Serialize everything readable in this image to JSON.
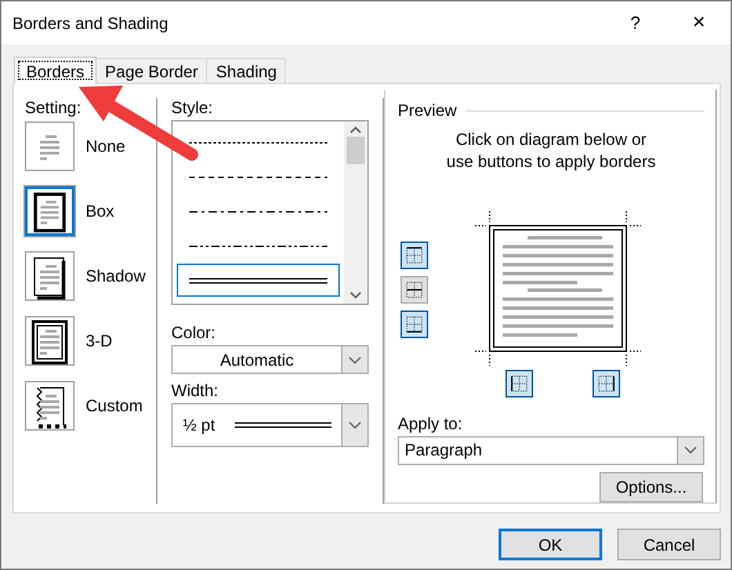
{
  "window": {
    "title": "Borders and Shading",
    "help": "?",
    "close": "×"
  },
  "tabs": [
    {
      "label": "Borders",
      "selected": true
    },
    {
      "label": "Page Border",
      "selected": false
    },
    {
      "label": "Shading",
      "selected": false
    }
  ],
  "setting": {
    "label": "Setting:",
    "items": [
      {
        "label": "None",
        "kind": "none",
        "selected": false
      },
      {
        "label": "Box",
        "kind": "box",
        "selected": true
      },
      {
        "label": "Shadow",
        "kind": "shadow",
        "selected": false
      },
      {
        "label": "3-D",
        "kind": "threed",
        "selected": false
      },
      {
        "label": "Custom",
        "kind": "custom",
        "selected": false
      }
    ]
  },
  "style": {
    "label": "Style:",
    "items": [
      {
        "kind": "dotted",
        "selected": false
      },
      {
        "kind": "dashed",
        "selected": false
      },
      {
        "kind": "dash-dot",
        "selected": false
      },
      {
        "kind": "dash-dot-dot",
        "selected": false
      },
      {
        "kind": "double",
        "selected": true
      }
    ]
  },
  "color": {
    "label": "Color:",
    "value": "Automatic"
  },
  "width": {
    "label": "Width:",
    "value": "½ pt"
  },
  "preview": {
    "label": "Preview",
    "hint": "Click on diagram below or\nuse buttons to apply borders",
    "buttons": [
      {
        "kind": "top",
        "on": true
      },
      {
        "kind": "inside-horizontal",
        "on": false
      },
      {
        "kind": "bottom",
        "on": true
      },
      {
        "kind": "left",
        "on": true
      },
      {
        "kind": "right",
        "on": true
      }
    ]
  },
  "apply_to": {
    "label": "Apply to:",
    "value": "Paragraph"
  },
  "options_button": "Options...",
  "ok_button": "OK",
  "cancel_button": "Cancel"
}
